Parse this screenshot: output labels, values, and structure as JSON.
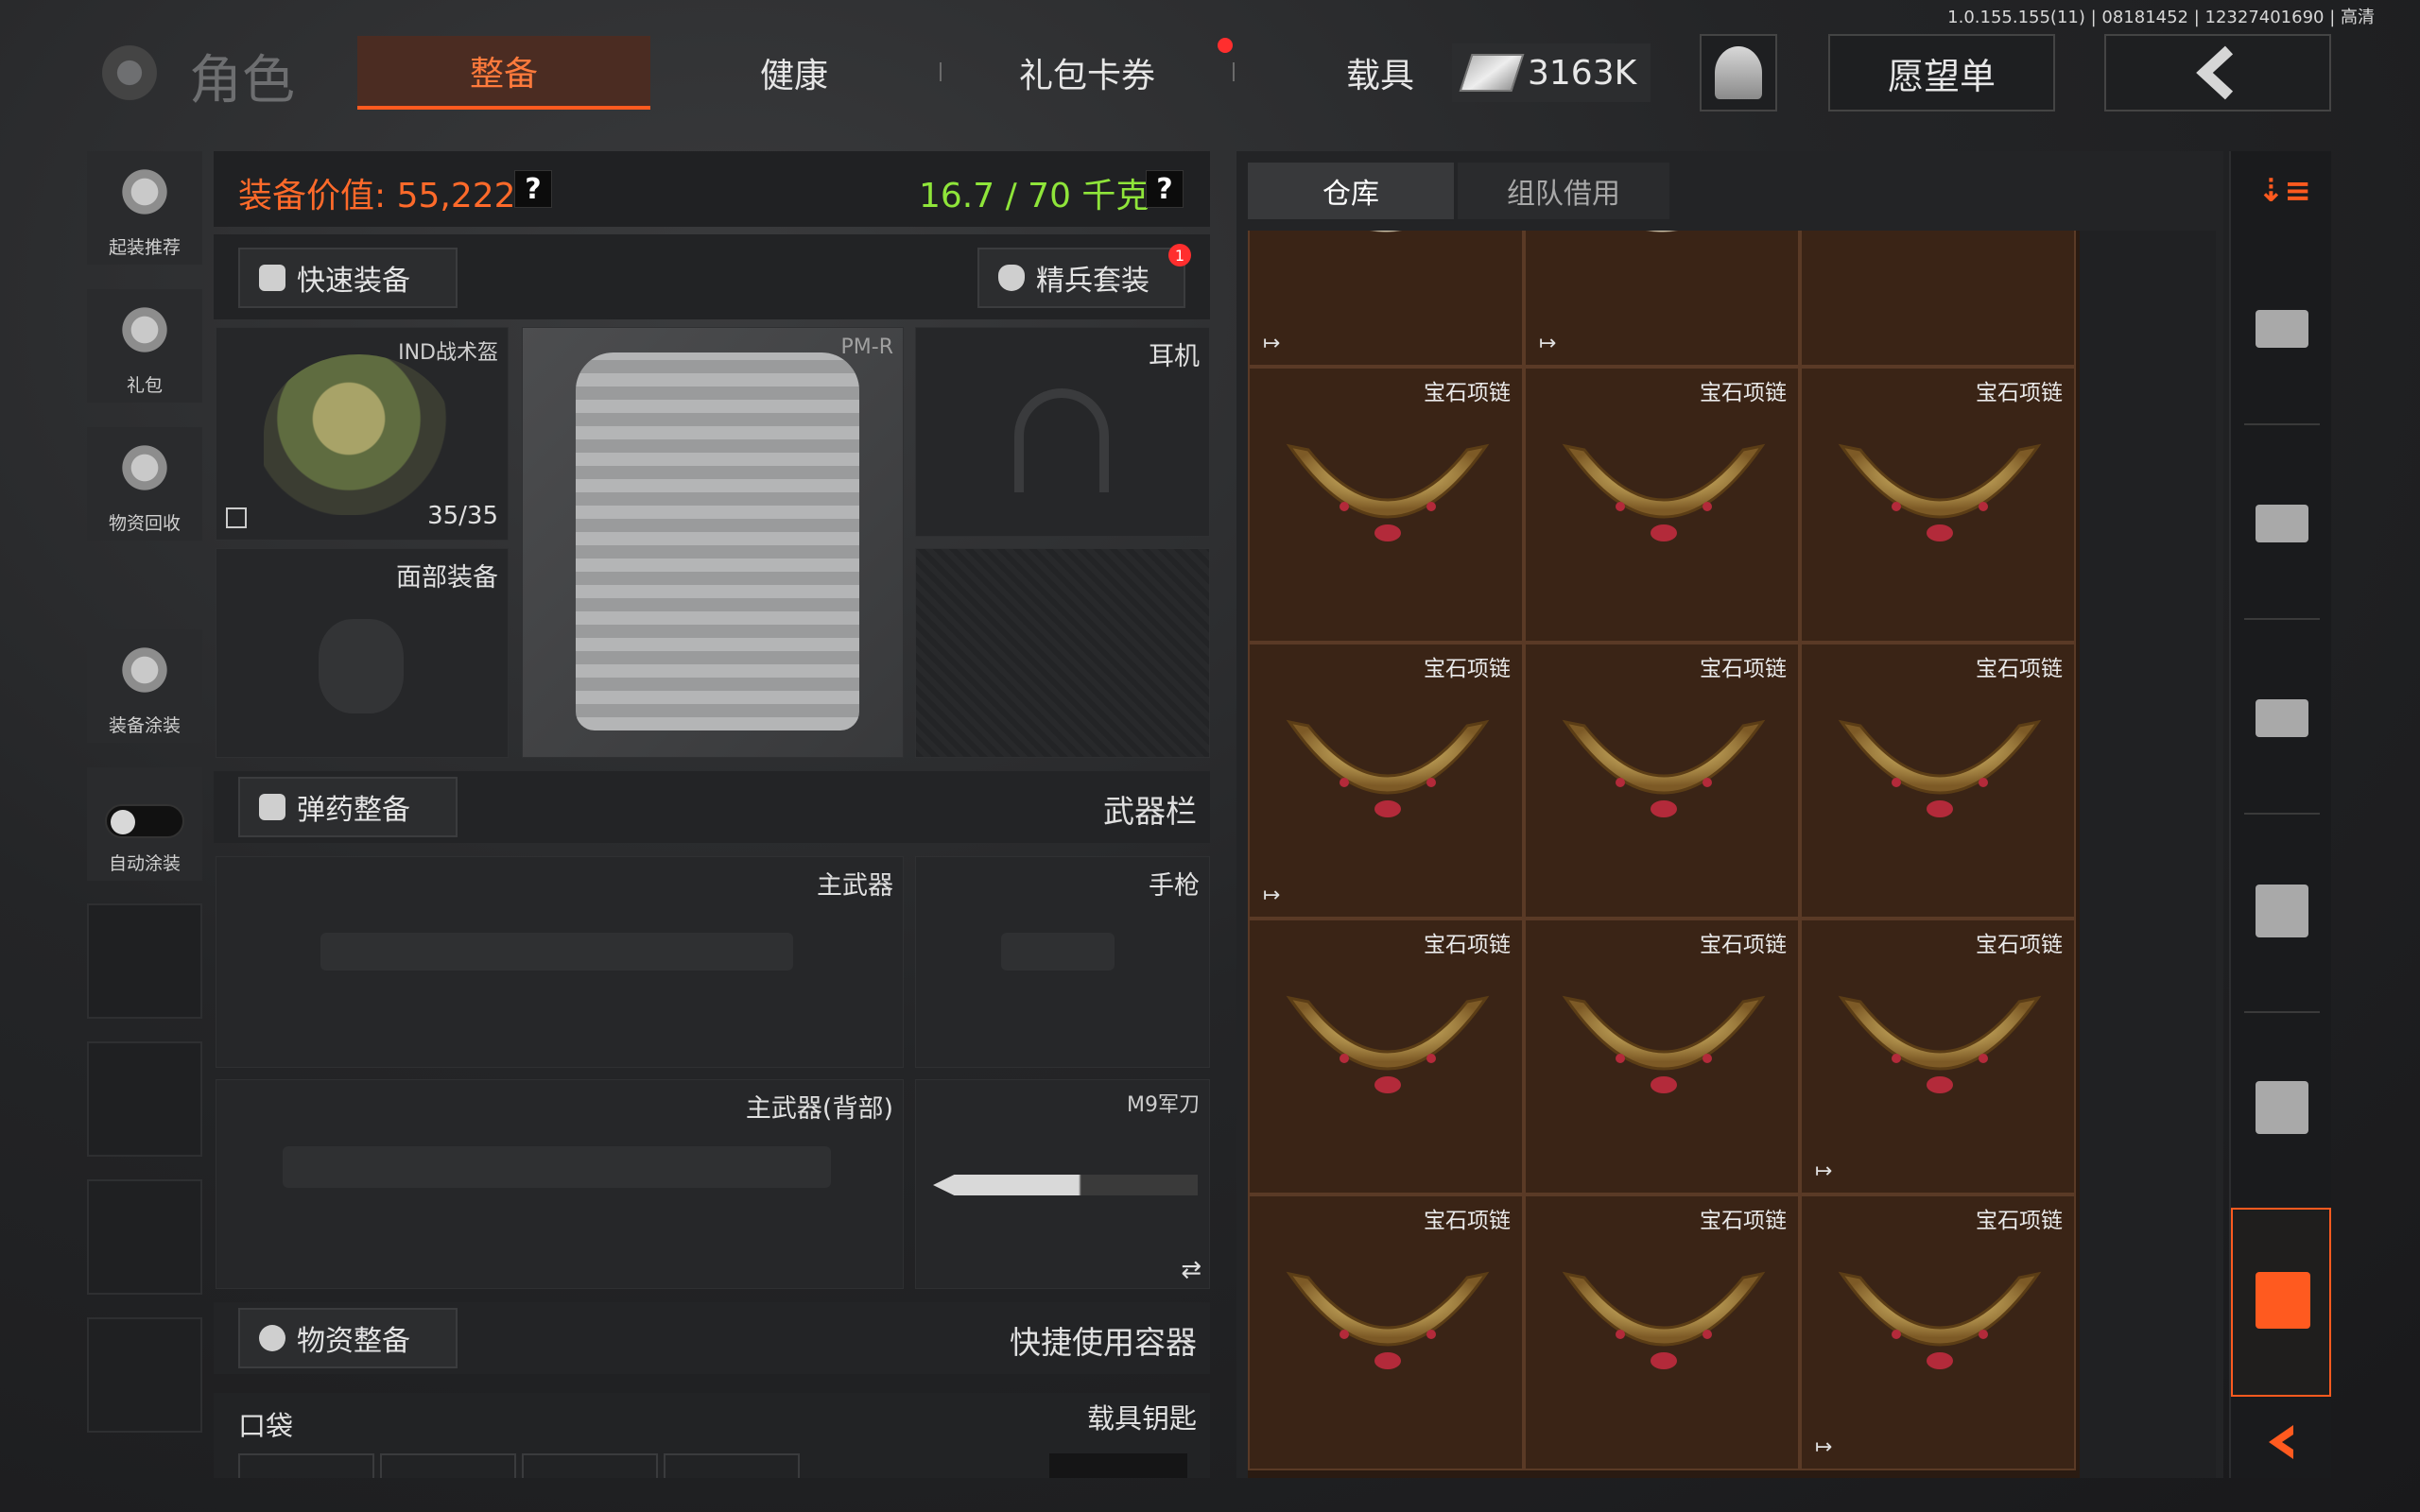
{
  "build_info": "1.0.155.155(11) | 08181452 | 12327401690 | 高清",
  "header": {
    "title": "角色",
    "tabs": [
      {
        "label": "整备",
        "active": true
      },
      {
        "label": "健康",
        "active": false
      },
      {
        "label": "礼包卡券",
        "active": false
      },
      {
        "label": "载具",
        "active": false
      }
    ],
    "currency": "3163K",
    "wishlist_label": "愿望单",
    "back_icon": "chevron-left-icon"
  },
  "sidebar": {
    "items": [
      {
        "label": "起装推荐",
        "icon": "loadout-recommend-icon"
      },
      {
        "label": "礼包",
        "icon": "gift-icon"
      },
      {
        "label": "物资回收",
        "icon": "recycle-icon"
      },
      {
        "label": "装备涂装",
        "icon": "skin-icon"
      },
      {
        "label": "自动涂装",
        "icon": "toggle-icon"
      }
    ]
  },
  "equipment": {
    "value_label": "装备价值: 55,222",
    "weight_label": "16.7 / 70 千克",
    "help_label": "?",
    "quick_equip": "快速装备",
    "elite_set": "精兵套装",
    "elite_badge": "1",
    "helmet": {
      "name": "IND战术盔",
      "durability": "35/35"
    },
    "armor": {
      "name": "PM-R"
    },
    "headset": "耳机",
    "face": "面部装备",
    "ammo_btn": "弹药整备",
    "weapons_label": "武器栏",
    "primary": "主武器",
    "pistol": "手枪",
    "primary_back": "主武器(背部)",
    "melee": "M9军刀",
    "swap_icon": "⇄",
    "supply_btn": "物资整备",
    "quick_container": "快捷使用容器",
    "pocket": "口袋",
    "vehicle_key": "载具钥匙"
  },
  "inventory": {
    "tabs": [
      {
        "label": "仓库",
        "active": true
      },
      {
        "label": "组队借用",
        "active": false
      }
    ],
    "item_name": "宝石项链",
    "colors": {
      "cell": "#3a2416",
      "accent": "#ff5a1f"
    }
  }
}
